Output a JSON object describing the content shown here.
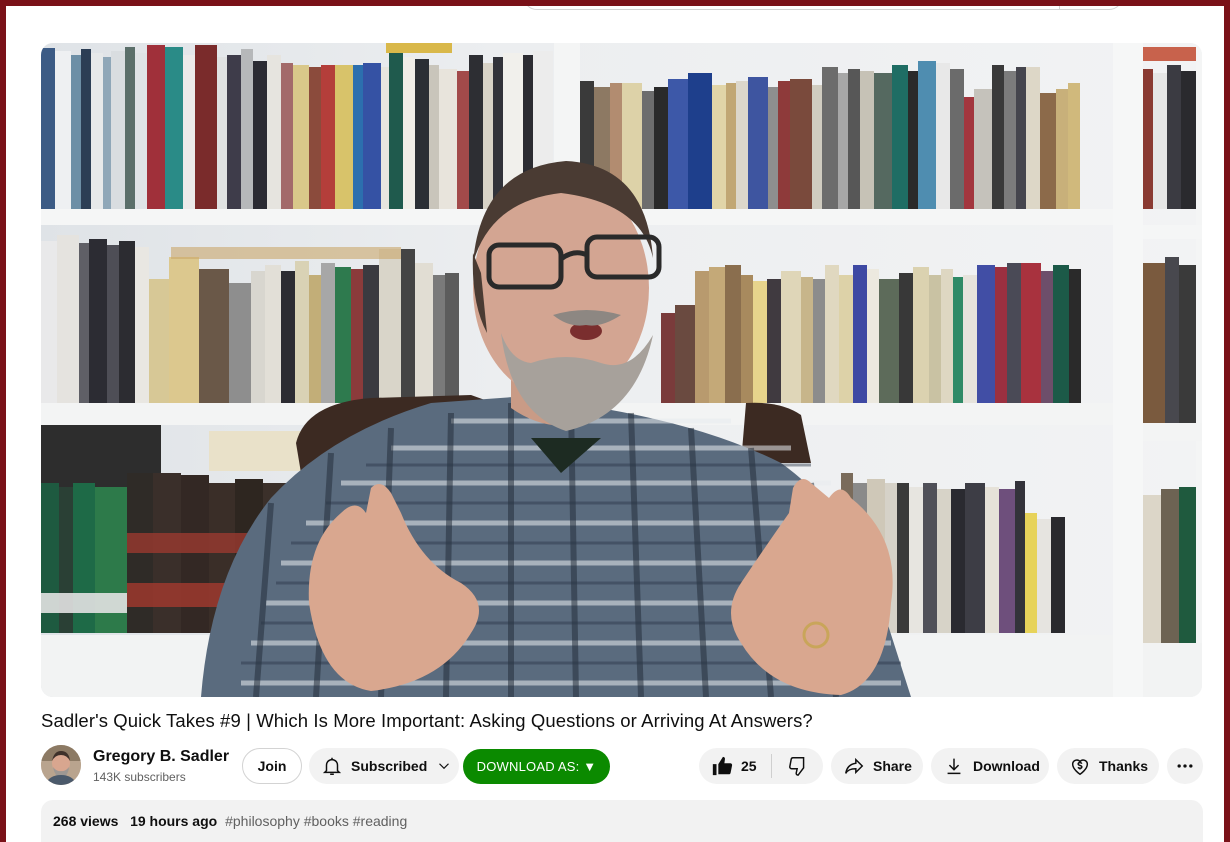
{
  "video": {
    "title": "Sadler's Quick Takes #9 | Which Is More Important: Asking Questions or Arriving At Answers?",
    "thumbnail_subject": "man-gesturing-in-front-of-bookshelves"
  },
  "channel": {
    "name": "Gregory B. Sadler",
    "subscribers": "143K subscribers",
    "join_label": "Join",
    "subscribed_label": "Subscribed"
  },
  "actions": {
    "download_as_label": "DOWNLOAD AS: ▼",
    "like_count": "25",
    "share_label": "Share",
    "download_label": "Download",
    "thanks_label": "Thanks"
  },
  "description": {
    "views": "268 views",
    "age": "19 hours ago",
    "tags": "#philosophy #books #reading"
  },
  "colors": {
    "frame_border": "#7a1118",
    "download_as_bg": "#0b8a00",
    "pill_bg": "#f2f2f2"
  },
  "icons": [
    "bell-icon",
    "chevron-down-icon",
    "thumbs-up-icon",
    "thumbs-down-icon",
    "share-arrow-icon",
    "download-icon",
    "thanks-heart-dollar-icon",
    "more-horizontal-icon"
  ]
}
